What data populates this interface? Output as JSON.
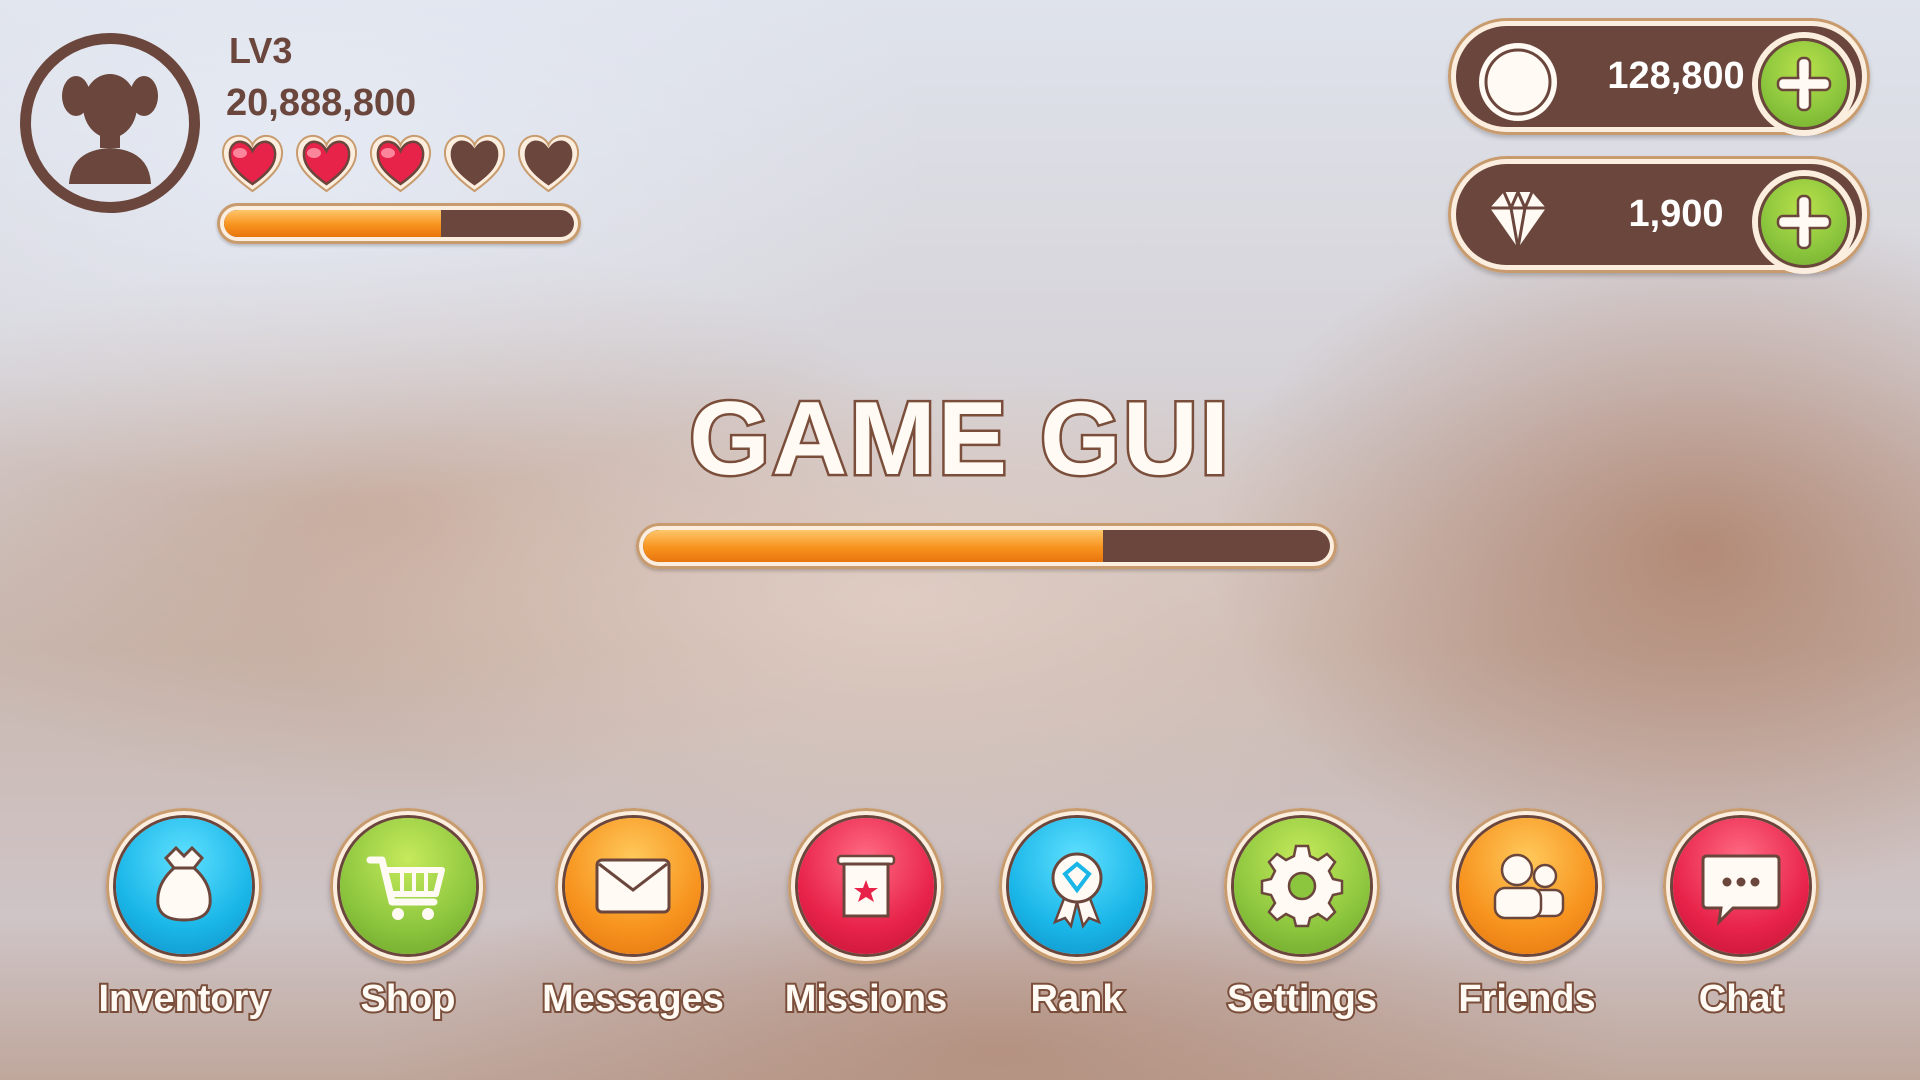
{
  "player": {
    "level": "LV3",
    "score": "20,888,800",
    "hearts": {
      "filled": 3,
      "total": 5
    },
    "xp_progress": 0.62
  },
  "currency": {
    "coins": "128,800",
    "gems": "1,900"
  },
  "title": "GAME GUI",
  "loading_progress": 0.67,
  "menu": [
    {
      "label": "Inventory",
      "icon": "bag-icon",
      "color": "#1ab6e8"
    },
    {
      "label": "Shop",
      "icon": "cart-icon",
      "color": "#8cc63e"
    },
    {
      "label": "Messages",
      "icon": "envelope-icon",
      "color": "#f7931e"
    },
    {
      "label": "Missions",
      "icon": "scroll-icon",
      "color": "#e8234a"
    },
    {
      "label": "Rank",
      "icon": "ribbon-icon",
      "color": "#1ab6e8"
    },
    {
      "label": "Settings",
      "icon": "gear-icon",
      "color": "#8cc63e"
    },
    {
      "label": "Friends",
      "icon": "friends-icon",
      "color": "#f7931e"
    },
    {
      "label": "Chat",
      "icon": "chat-icon",
      "color": "#e8234a"
    }
  ],
  "colors": {
    "brown": "#6b463c",
    "cream": "#fbeede",
    "progress_orange": "#f7931e",
    "heart_red": "#e8234a",
    "plus_green": "#8cc63e"
  }
}
